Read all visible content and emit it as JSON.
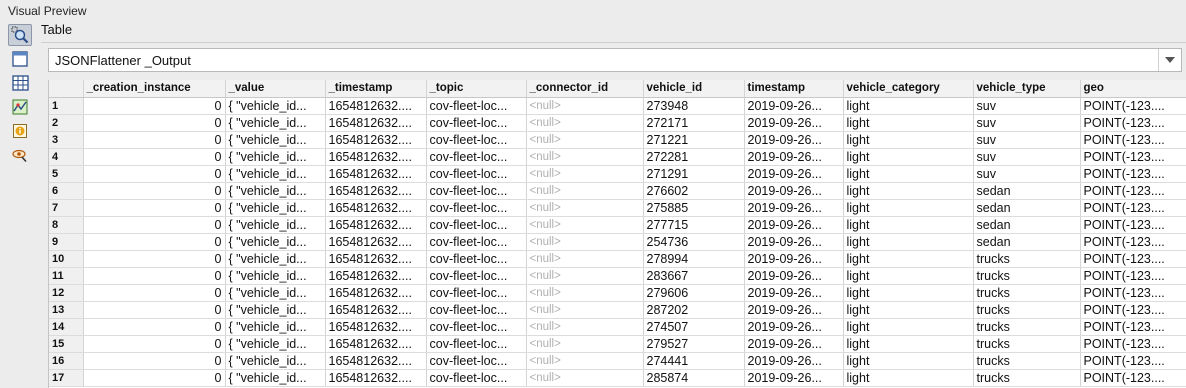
{
  "panel": {
    "title": "Visual Preview"
  },
  "section": {
    "title": "Table"
  },
  "dropdown": {
    "selected": "JSONFlattener _Output"
  },
  "toolbar": {
    "tools": [
      {
        "name": "zoom-inspect-icon",
        "active": true
      },
      {
        "name": "window-icon",
        "active": false
      },
      {
        "name": "table-grid-icon",
        "active": false
      },
      {
        "name": "map-icon",
        "active": false
      },
      {
        "name": "info-icon",
        "active": false
      },
      {
        "name": "eye-search-icon",
        "active": false
      }
    ]
  },
  "table": {
    "columns": [
      "",
      "_creation_instance",
      "_value",
      "_timestamp",
      "_topic",
      "_connector_id",
      "vehicle_id",
      "timestamp",
      "vehicle_category",
      "vehicle_type",
      "geo"
    ],
    "rows": [
      [
        "1",
        "0",
        "{ \"vehicle_id...",
        "1654812632....",
        "cov-fleet-loc...",
        "<null>",
        "273948",
        "2019-09-26...",
        "light",
        "suv",
        "POINT(-123...."
      ],
      [
        "2",
        "0",
        "{ \"vehicle_id...",
        "1654812632....",
        "cov-fleet-loc...",
        "<null>",
        "272171",
        "2019-09-26...",
        "light",
        "suv",
        "POINT(-123...."
      ],
      [
        "3",
        "0",
        "{ \"vehicle_id...",
        "1654812632....",
        "cov-fleet-loc...",
        "<null>",
        "271221",
        "2019-09-26...",
        "light",
        "suv",
        "POINT(-123...."
      ],
      [
        "4",
        "0",
        "{ \"vehicle_id...",
        "1654812632....",
        "cov-fleet-loc...",
        "<null>",
        "272281",
        "2019-09-26...",
        "light",
        "suv",
        "POINT(-123...."
      ],
      [
        "5",
        "0",
        "{ \"vehicle_id...",
        "1654812632....",
        "cov-fleet-loc...",
        "<null>",
        "271291",
        "2019-09-26...",
        "light",
        "suv",
        "POINT(-123...."
      ],
      [
        "6",
        "0",
        "{ \"vehicle_id...",
        "1654812632....",
        "cov-fleet-loc...",
        "<null>",
        "276602",
        "2019-09-26...",
        "light",
        "sedan",
        "POINT(-123...."
      ],
      [
        "7",
        "0",
        "{ \"vehicle_id...",
        "1654812632....",
        "cov-fleet-loc...",
        "<null>",
        "275885",
        "2019-09-26...",
        "light",
        "sedan",
        "POINT(-123...."
      ],
      [
        "8",
        "0",
        "{ \"vehicle_id...",
        "1654812632....",
        "cov-fleet-loc...",
        "<null>",
        "277715",
        "2019-09-26...",
        "light",
        "sedan",
        "POINT(-123...."
      ],
      [
        "9",
        "0",
        "{ \"vehicle_id...",
        "1654812632....",
        "cov-fleet-loc...",
        "<null>",
        "254736",
        "2019-09-26...",
        "light",
        "sedan",
        "POINT(-123...."
      ],
      [
        "10",
        "0",
        "{ \"vehicle_id...",
        "1654812632....",
        "cov-fleet-loc...",
        "<null>",
        "278994",
        "2019-09-26...",
        "light",
        "trucks",
        "POINT(-123...."
      ],
      [
        "11",
        "0",
        "{ \"vehicle_id...",
        "1654812632....",
        "cov-fleet-loc...",
        "<null>",
        "283667",
        "2019-09-26...",
        "light",
        "trucks",
        "POINT(-123...."
      ],
      [
        "12",
        "0",
        "{ \"vehicle_id...",
        "1654812632....",
        "cov-fleet-loc...",
        "<null>",
        "279606",
        "2019-09-26...",
        "light",
        "trucks",
        "POINT(-123...."
      ],
      [
        "13",
        "0",
        "{ \"vehicle_id...",
        "1654812632....",
        "cov-fleet-loc...",
        "<null>",
        "287202",
        "2019-09-26...",
        "light",
        "trucks",
        "POINT(-123...."
      ],
      [
        "14",
        "0",
        "{ \"vehicle_id...",
        "1654812632....",
        "cov-fleet-loc...",
        "<null>",
        "274507",
        "2019-09-26...",
        "light",
        "trucks",
        "POINT(-123...."
      ],
      [
        "15",
        "0",
        "{ \"vehicle_id...",
        "1654812632....",
        "cov-fleet-loc...",
        "<null>",
        "279527",
        "2019-09-26...",
        "light",
        "trucks",
        "POINT(-123...."
      ],
      [
        "16",
        "0",
        "{ \"vehicle_id...",
        "1654812632....",
        "cov-fleet-loc...",
        "<null>",
        "274441",
        "2019-09-26...",
        "light",
        "trucks",
        "POINT(-123...."
      ],
      [
        "17",
        "0",
        "{ \"vehicle_id...",
        "1654812632....",
        "cov-fleet-loc...",
        "<null>",
        "285874",
        "2019-09-26...",
        "light",
        "trucks",
        "POINT(-123...."
      ]
    ]
  }
}
